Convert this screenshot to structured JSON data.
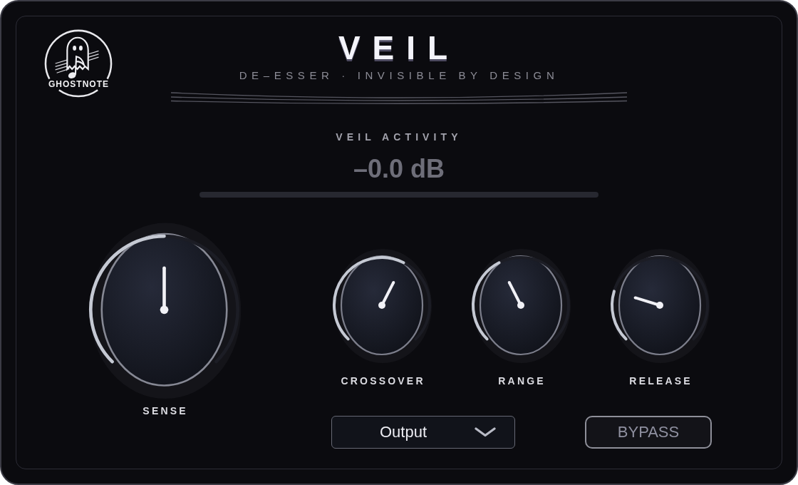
{
  "brand": {
    "name": "GHOSTNOTE"
  },
  "header": {
    "title": "VEIL",
    "subtitle": "DE–ESSER · INVISIBLE BY DESIGN"
  },
  "activity_meter": {
    "label": "VEIL ACTIVITY",
    "reading": "–0.0 dB",
    "level": 0
  },
  "large_knob": {
    "label": "SENSE",
    "level": 0.5
  },
  "knobs": [
    {
      "label": "CROSSOVER",
      "level": 0.6
    },
    {
      "label": "RANGE",
      "level": 0.4
    },
    {
      "label": "RELEASE",
      "level": 0.23
    }
  ],
  "output_dropdown": {
    "value": "Output"
  },
  "bypass_button": {
    "label": "BYPASS",
    "on": false
  }
}
